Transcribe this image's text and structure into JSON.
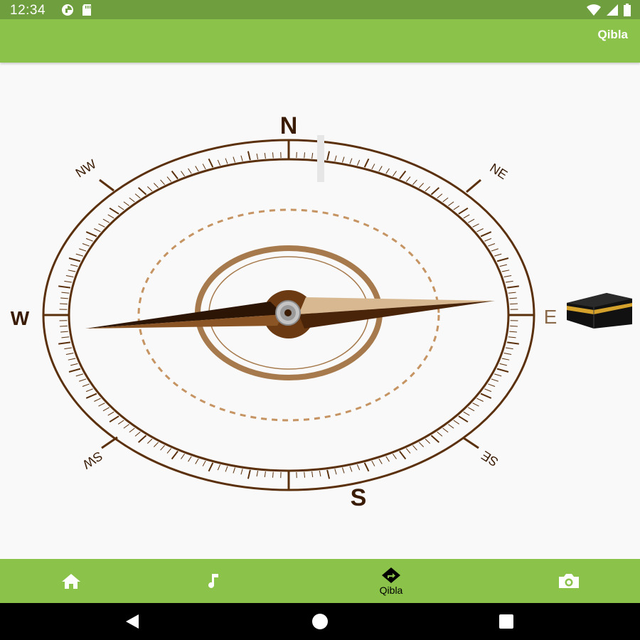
{
  "status_bar": {
    "time": "12:34",
    "left_icons": [
      "data-saver-icon",
      "sd-card-icon"
    ],
    "right_icons": [
      "wifi-icon",
      "signal-icon",
      "battery-icon"
    ]
  },
  "app_bar": {
    "title": "Qibla"
  },
  "compass": {
    "cardinals": {
      "north": "N",
      "south": "S",
      "east": "E",
      "west": "W"
    },
    "intercardinals": {
      "northwest": "NW",
      "northeast": "NE",
      "southwest": "SW",
      "southeast": "SE"
    },
    "qibla_icon": "kaaba-icon",
    "colors": {
      "ring": "#5b300c",
      "needle_dark": "#4a2408",
      "needle_light": "#c9a57a",
      "dashed_circle": "#c69462",
      "hub": "#6b3a12"
    }
  },
  "bottom_nav": {
    "items": [
      {
        "icon": "home-icon",
        "label": ""
      },
      {
        "icon": "music-note-icon",
        "label": ""
      },
      {
        "icon": "direction-icon",
        "label": "Qibla"
      },
      {
        "icon": "camera-icon",
        "label": ""
      }
    ],
    "active_index": 2
  },
  "system_nav": {
    "icons": [
      "back-icon",
      "home-circle-icon",
      "recents-icon"
    ]
  },
  "colors": {
    "status_bar": "#6f9e3f",
    "app_bar": "#8bc34a",
    "bottom_nav": "#8bc34a",
    "background": "#f9f9f9"
  }
}
